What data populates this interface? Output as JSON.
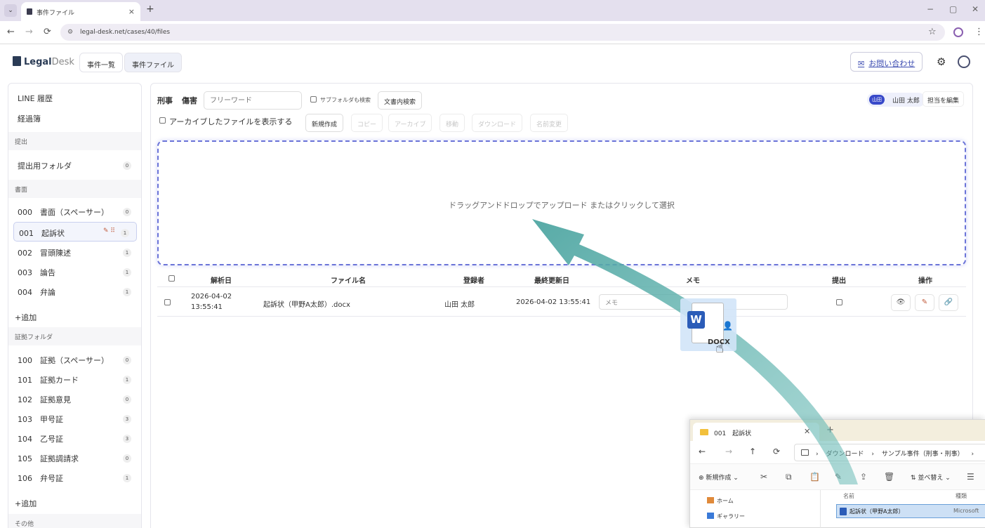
{
  "browser": {
    "tab_title": "事件ファイル",
    "url": "legal-desk.net/cases/40/files",
    "new_tab": "+",
    "close_tab": "×",
    "window_controls": [
      "−",
      "▢",
      "✕"
    ],
    "icons": {
      "back": "←",
      "forward": "→",
      "reload": "⟳",
      "bookmark": "☆",
      "menu": "⋮",
      "tab_menu": "⌄",
      "site_info": "⚙"
    }
  },
  "app": {
    "logo_legal": "Legal",
    "logo_desk": "Desk",
    "nav": {
      "cases": "事件一覧",
      "files": "事件ファイル"
    },
    "contact": "お問い合わせ",
    "contact_icon": "✉",
    "settings_icon": "⚙"
  },
  "sidebar": {
    "top_items": [
      {
        "label": "LINE 履歴"
      },
      {
        "label": "経過簿"
      }
    ],
    "sections": [
      {
        "header": "提出",
        "items": [
          {
            "label": "提出用フォルダ",
            "count": "0"
          }
        ]
      },
      {
        "header": "書面",
        "items": [
          {
            "label": "000　書面（スペーサー）",
            "count": "0"
          },
          {
            "label": "001　起訴状",
            "count": "1",
            "selected": true
          },
          {
            "label": "002　冒頭陳述",
            "count": "1"
          },
          {
            "label": "003　論告",
            "count": "1"
          },
          {
            "label": "004　弁論",
            "count": "1"
          }
        ],
        "add": "+追加"
      },
      {
        "header": "証拠フォルダ",
        "items": [
          {
            "label": "100　証拠（スペーサー）",
            "count": "0"
          },
          {
            "label": "101　証拠カード",
            "count": "1"
          },
          {
            "label": "102　証拠意見",
            "count": "0"
          },
          {
            "label": "103　甲号証",
            "count": "3"
          },
          {
            "label": "104　乙号証",
            "count": "3"
          },
          {
            "label": "105　証拠調請求",
            "count": "0"
          },
          {
            "label": "106　弁号証",
            "count": "1"
          }
        ],
        "add": "+追加"
      },
      {
        "header": "その他"
      }
    ],
    "selected_tools": "✎ ⠿"
  },
  "main": {
    "case_type": "刑事",
    "case_name": "傷害",
    "search_placeholder": "フリーワード",
    "subfolder_search": "サブフォルダも検索",
    "fulltext_search": "文書内検索",
    "show_archived": "アーカイブしたファイルを表示する",
    "actions": {
      "new": "新規作成",
      "copy": "コピー",
      "archive": "アーカイブ",
      "move": "移動",
      "download": "ダウンロード",
      "rename": "名前変更"
    },
    "assignee": {
      "initials": "山田",
      "name": "山田 太郎"
    },
    "edit_assignee": "担当を編集",
    "dropzone": "ドラッグアンドドロップでアップロード またはクリックして選択",
    "table": {
      "headers": [
        "解析日",
        "ファイル名",
        "登録者",
        "最終更新日",
        "メモ",
        "提出",
        "操作"
      ],
      "rows": [
        {
          "date": "2026-04-02",
          "time": "13:55:41",
          "filename": "起訴状（甲野A太郎）.docx",
          "registrant": "山田 太郎",
          "updated": "2026-04-02 13:55:41",
          "memo_placeholder": "メモ"
        }
      ],
      "op_icons": [
        "👁",
        "✎",
        "🔗"
      ]
    }
  },
  "drag_item": {
    "app_letter": "W",
    "label": "DOCX",
    "user_icon": "👤",
    "cursor": "☝"
  },
  "explorer": {
    "tab": "001　起訴状",
    "close": "✕",
    "new_tab": "+",
    "nav": {
      "back": "←",
      "forward": "→",
      "up": "↑",
      "refresh": "⟳"
    },
    "breadcrumb": [
      "ダウンロード",
      "サンプル事件（刑事・刑事）"
    ],
    "crumb_sep": "›",
    "new_button": "新規作成",
    "sort_button": "並べ替え",
    "toolbar_icons": [
      "✂",
      "⧉",
      "📋",
      "✎",
      "⇪",
      "🗑"
    ],
    "nav_pane": [
      {
        "label": "ホーム"
      },
      {
        "label": "ギャラリー"
      }
    ],
    "columns": {
      "name": "名前",
      "kind": "種類"
    },
    "file": {
      "name": "起訴状（甲野A太郎）",
      "kind": "Microsoft"
    }
  },
  "colors": {
    "accent": "#3849c9",
    "dropzone_border": "#6b74d8",
    "arrow": "#5fb0ad"
  }
}
